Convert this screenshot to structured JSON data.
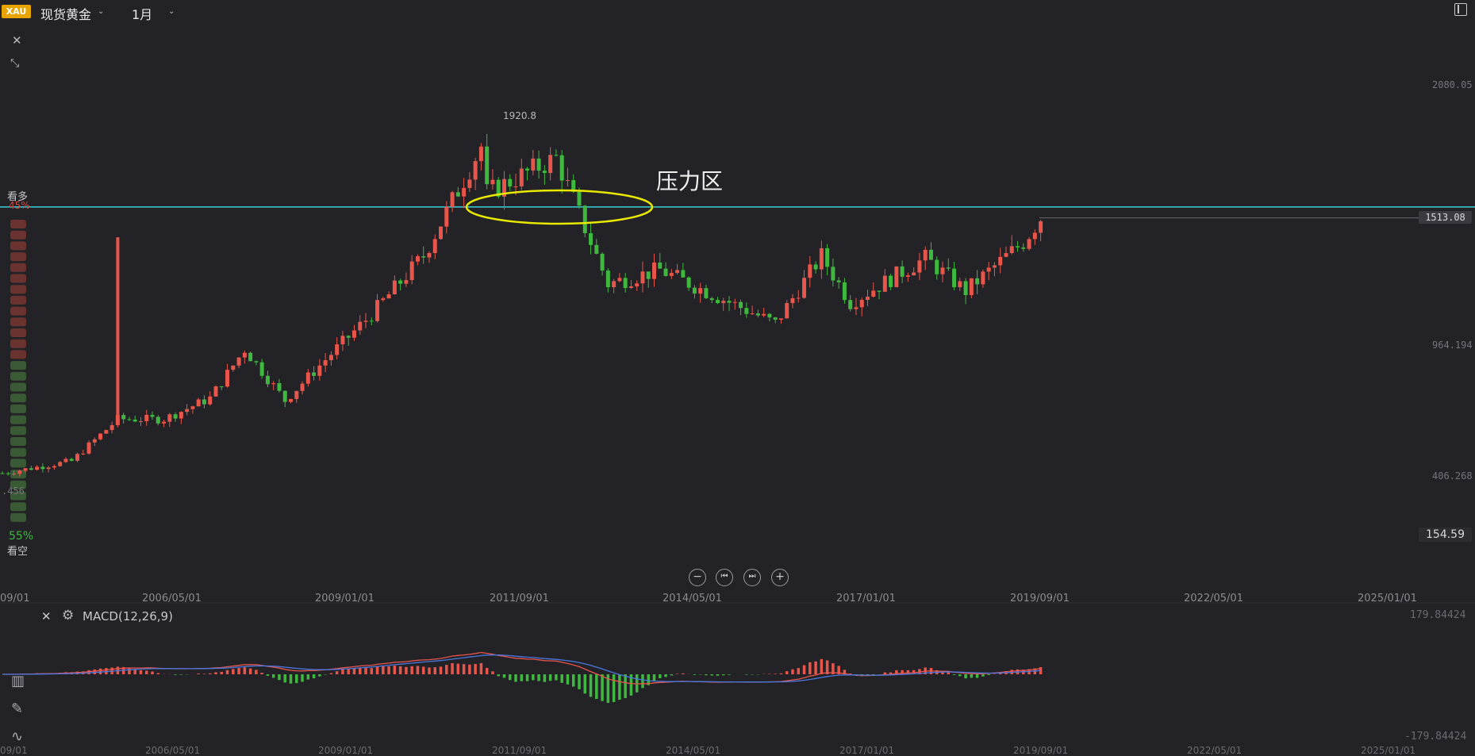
{
  "header": {
    "badge": "XAU",
    "symbol": "现货黄金",
    "period": "1月"
  },
  "price_axis": {
    "labels": [
      "2080.05",
      "964.194",
      "406.268"
    ],
    "left_partial_label": ".456",
    "last_price": "1513.08",
    "low_price": "154.59",
    "peak_label": "1920.8"
  },
  "sentiment": {
    "bull_label": "看多",
    "bull_pct": "45%",
    "bear_label": "看空",
    "bear_pct": "55%",
    "bull_fraction": 0.45
  },
  "annotation": {
    "text": "压力区"
  },
  "time_axis": {
    "labels": [
      "09/01",
      "2006/05/01",
      "2009/01/01",
      "2011/09/01",
      "2014/05/01",
      "2017/01/01",
      "2019/09/01",
      "2022/05/01",
      "2025/01/01"
    ]
  },
  "macd": {
    "title": "MACD(12,26,9)",
    "top_label": "179.84424",
    "bottom_label": "-179.84424"
  },
  "controls": {
    "zoom_out": "−",
    "prev": "⏮",
    "next": "⏭",
    "zoom_in": "+"
  },
  "colors": {
    "up": "#e8554b",
    "down": "#3fb83f",
    "bg": "#232327",
    "cyan_line": "#3ad0d8",
    "ellipse": "#e8e800",
    "macd_dif": "#e8554b",
    "macd_dea": "#4a78e0"
  },
  "chart_data": {
    "type": "candlestick",
    "frequency": "monthly",
    "x_range": [
      "2004-09-01",
      "2019-09-01"
    ],
    "y_range": [
      154.59,
      2080.05
    ],
    "series_close_approx": [
      {
        "x": "2004-09-01",
        "y": 418
      },
      {
        "x": "2005-09-01",
        "y": 470
      },
      {
        "x": "2006-05-01",
        "y": 650
      },
      {
        "x": "2007-01-01",
        "y": 650
      },
      {
        "x": "2007-09-01",
        "y": 740
      },
      {
        "x": "2008-03-01",
        "y": 950
      },
      {
        "x": "2008-10-01",
        "y": 730
      },
      {
        "x": "2009-06-01",
        "y": 930
      },
      {
        "x": "2010-01-01",
        "y": 1100
      },
      {
        "x": "2010-10-01",
        "y": 1350
      },
      {
        "x": "2011-08-01",
        "y": 1820
      },
      {
        "x": "2011-09-01",
        "y": 1620
      },
      {
        "x": "2012-09-01",
        "y": 1770
      },
      {
        "x": "2013-06-01",
        "y": 1230
      },
      {
        "x": "2014-03-01",
        "y": 1290
      },
      {
        "x": "2015-11-01",
        "y": 1060
      },
      {
        "x": "2016-07-01",
        "y": 1350
      },
      {
        "x": "2016-12-01",
        "y": 1150
      },
      {
        "x": "2018-01-01",
        "y": 1340
      },
      {
        "x": "2018-08-01",
        "y": 1200
      },
      {
        "x": "2019-06-01",
        "y": 1410
      },
      {
        "x": "2019-09-01",
        "y": 1513.08
      }
    ],
    "resistance_level": 1560
  }
}
